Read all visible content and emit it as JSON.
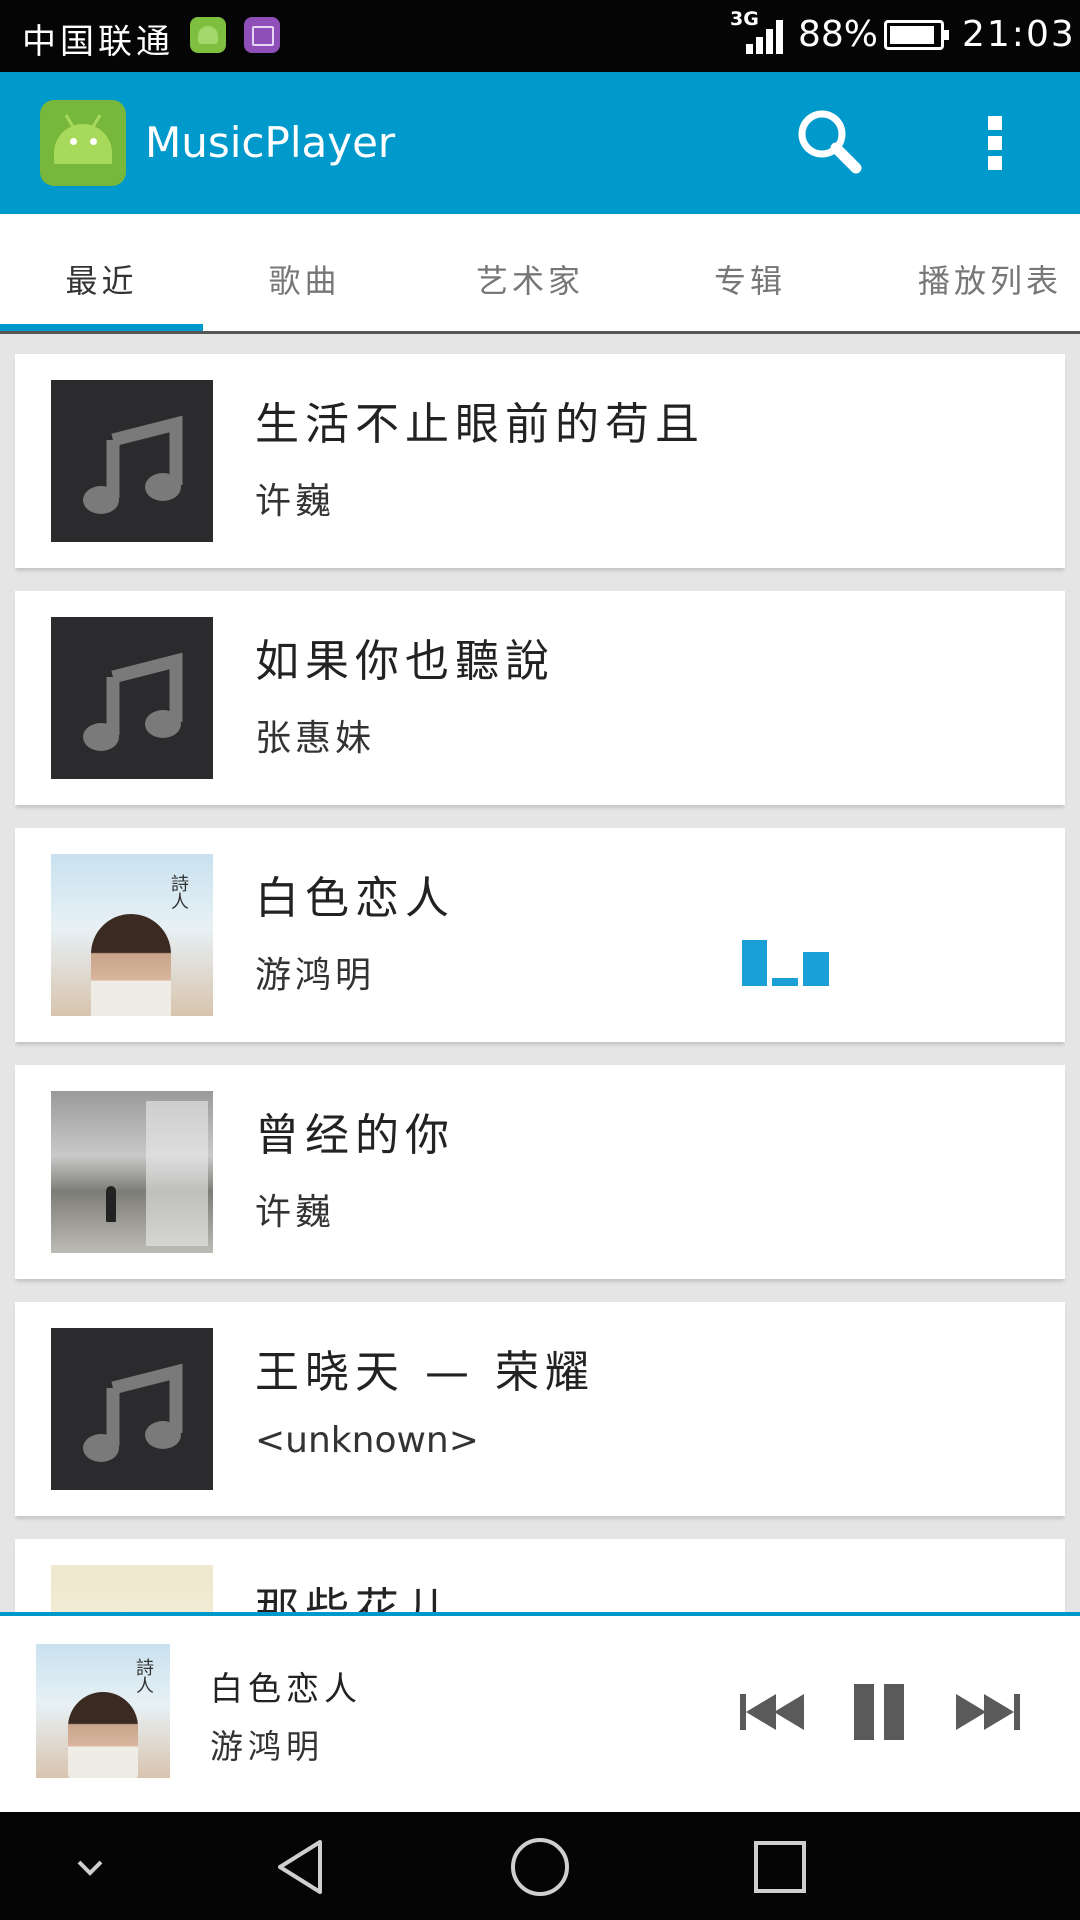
{
  "status_bar": {
    "carrier": "中国联通",
    "network": "3G",
    "battery_percent": "88%",
    "time": "21:03",
    "notification_icons": [
      "android-notification-icon",
      "image-notification-icon"
    ]
  },
  "action_bar": {
    "title": "MusicPlayer",
    "icons": [
      "app-logo-icon",
      "search-icon",
      "overflow-menu-icon"
    ],
    "color": "#0099cc"
  },
  "tabs": [
    {
      "label": "最近",
      "active": true
    },
    {
      "label": "歌曲",
      "active": false
    },
    {
      "label": "艺术家",
      "active": false
    },
    {
      "label": "专辑",
      "active": false
    },
    {
      "label": "播放列表",
      "active": false
    }
  ],
  "songs": [
    {
      "title": "生活不止眼前的苟且",
      "artist": "许巍",
      "art": "music-note-placeholder"
    },
    {
      "title": "如果你也聽說",
      "artist": "张惠妹",
      "art": "music-note-placeholder"
    },
    {
      "title": "白色恋人",
      "artist": "游鸿明",
      "art": "album-cover-image",
      "playing": true
    },
    {
      "title": "曾经的你",
      "artist": "许巍",
      "art": "album-cover-image"
    },
    {
      "title": "王晓天 — 荣耀",
      "artist": "<unknown>",
      "art": "music-note-placeholder"
    },
    {
      "title": "那些花儿",
      "artist": "",
      "art": "album-cover-image"
    }
  ],
  "now_playing": {
    "title": "白色恋人",
    "artist": "游鸿明",
    "controls": [
      "previous-icon",
      "pause-icon",
      "next-icon"
    ]
  },
  "nav_bar": {
    "buttons": [
      "collapse-chevron-icon",
      "back-icon",
      "home-icon",
      "recents-icon"
    ]
  }
}
